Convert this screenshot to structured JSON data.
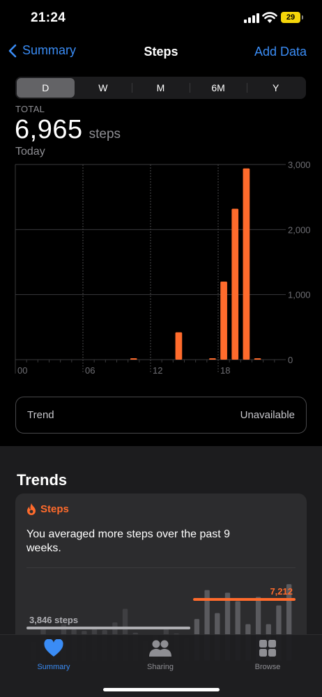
{
  "status": {
    "time": "21:24",
    "battery": "29"
  },
  "nav": {
    "back_label": "Summary",
    "title": "Steps",
    "action_label": "Add Data"
  },
  "segments": [
    "D",
    "W",
    "M",
    "6M",
    "Y"
  ],
  "active_segment": "D",
  "summary": {
    "total_label": "TOTAL",
    "value": "6,965",
    "unit": "steps",
    "date": "Today"
  },
  "chart_data": {
    "type": "bar",
    "x": [
      10,
      14,
      17,
      18,
      19,
      20,
      21
    ],
    "values": [
      15,
      420,
      20,
      1200,
      2320,
      2940,
      20
    ],
    "xlim": [
      0,
      24
    ],
    "ylim": [
      0,
      3000
    ],
    "x_ticks": [
      "00",
      "06",
      "12",
      "18"
    ],
    "y_ticks": [
      "3,000",
      "2,000",
      "1,000",
      "0"
    ],
    "bar_color": "#ff6b2c"
  },
  "trend": {
    "label": "Trend",
    "value": "Unavailable"
  },
  "trends_section": {
    "title": "Trends",
    "card": {
      "metric": "Steps",
      "text": "You averaged more steps over the past 9 weeks.",
      "old_avg_label": "3,846 steps",
      "old_avg_value": 3846,
      "new_avg_label": "7,212",
      "new_avg_value": 7212,
      "bars": [
        2200,
        3800,
        2700,
        4300,
        3700,
        3500,
        4000,
        3600,
        4500,
        6100,
        3300,
        2400,
        3100,
        4000,
        3200,
        2600,
        4900,
        8300,
        5600,
        8000,
        7000,
        4300,
        7500,
        4300,
        6500,
        9000
      ],
      "accent": "#ff6b2c"
    }
  },
  "tabs": [
    {
      "id": "summary",
      "label": "Summary",
      "icon": "heart-icon"
    },
    {
      "id": "sharing",
      "label": "Sharing",
      "icon": "people-icon"
    },
    {
      "id": "browse",
      "label": "Browse",
      "icon": "grid-icon"
    }
  ],
  "active_tab": "summary"
}
